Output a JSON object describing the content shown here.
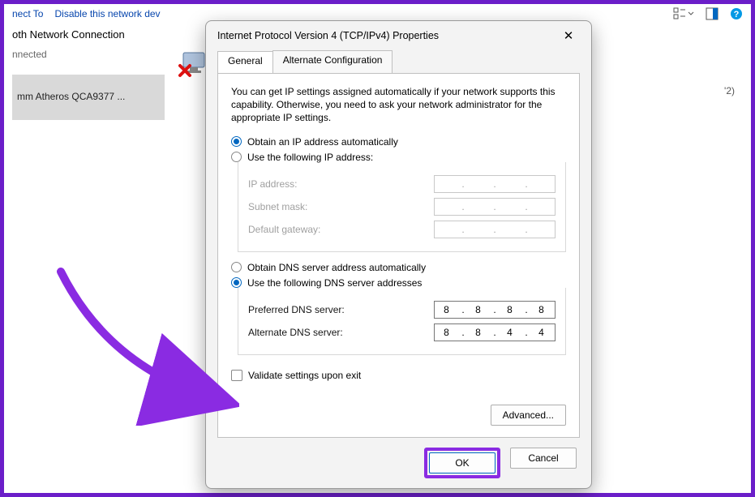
{
  "toolbar": {
    "link1": "nect To",
    "link2": "Disable this network dev"
  },
  "background": {
    "conn_name": "oth Network Connection",
    "conn_status": "nnected",
    "adapter": "mm Atheros QCA9377 ...",
    "right_partial": "'2)"
  },
  "dialog": {
    "title": "Internet Protocol Version 4 (TCP/IPv4) Properties",
    "tabs": {
      "general": "General",
      "alt": "Alternate Configuration"
    },
    "intro": "You can get IP settings assigned automatically if your network supports this capability. Otherwise, you need to ask your network administrator for the appropriate IP settings.",
    "radio_auto_ip": "Obtain an IP address automatically",
    "radio_manual_ip": "Use the following IP address:",
    "ip_label": "IP address:",
    "subnet_label": "Subnet mask:",
    "gateway_label": "Default gateway:",
    "radio_auto_dns": "Obtain DNS server address automatically",
    "radio_manual_dns": "Use the following DNS server addresses",
    "pref_dns_label": "Preferred DNS server:",
    "alt_dns_label": "Alternate DNS server:",
    "pref_dns": {
      "o1": "8",
      "o2": "8",
      "o3": "8",
      "o4": "8"
    },
    "alt_dns": {
      "o1": "8",
      "o2": "8",
      "o3": "4",
      "o4": "4"
    },
    "validate": "Validate settings upon exit",
    "advanced": "Advanced...",
    "ok": "OK",
    "cancel": "Cancel"
  }
}
